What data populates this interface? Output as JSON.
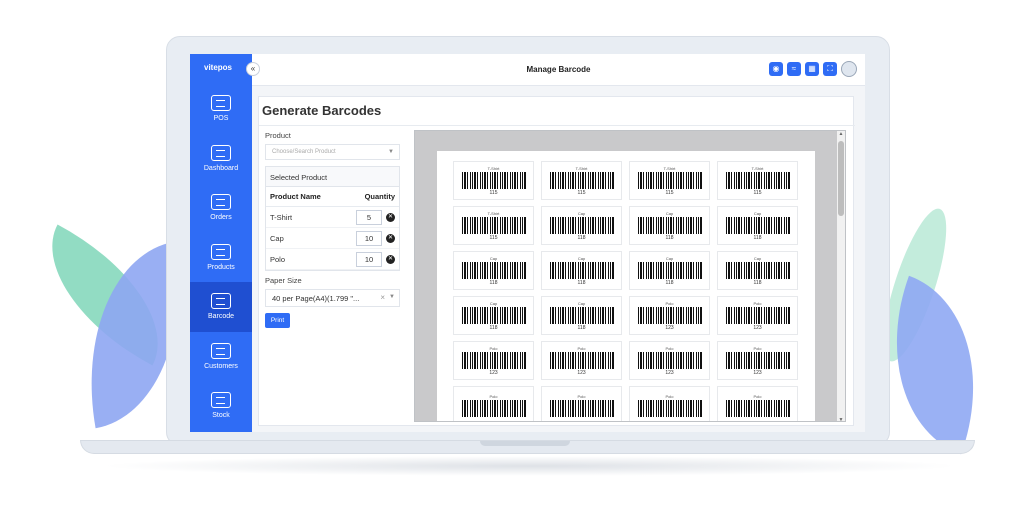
{
  "app": {
    "logo": "vitepos",
    "page_title": "Manage Barcode",
    "collapse_glyph": "«"
  },
  "sidebar": {
    "items": [
      {
        "label": "POS",
        "icon": "pos-icon"
      },
      {
        "label": "Dashboard",
        "icon": "dashboard-icon"
      },
      {
        "label": "Orders",
        "icon": "orders-icon"
      },
      {
        "label": "Products",
        "icon": "products-icon"
      },
      {
        "label": "Barcode",
        "icon": "barcode-icon",
        "active": true
      },
      {
        "label": "Customers",
        "icon": "customers-icon"
      },
      {
        "label": "Stock",
        "icon": "stock-icon"
      }
    ]
  },
  "topbar": {
    "icons": [
      "restaurant-icon",
      "wifi-icon",
      "calculator-icon",
      "fullscreen-icon"
    ],
    "accent_color": "#2f6cf5"
  },
  "main": {
    "title": "Generate Barcodes",
    "product_label": "Product",
    "product_placeholder": "Choose/Search Product",
    "selected_product_heading": "Selected Product",
    "table_headers": {
      "name": "Product Name",
      "quantity": "Quantity"
    },
    "products": [
      {
        "name": "T-Shirt",
        "qty": "5"
      },
      {
        "name": "Cap",
        "qty": "10"
      },
      {
        "name": "Polo",
        "qty": "10"
      }
    ],
    "paper_size_label": "Paper Size",
    "paper_size_value": "40 per Page(A4)(1.799 \"...",
    "clear_glyph": "×",
    "print_label": "Print"
  },
  "preview": {
    "labels": [
      {
        "name": "T-Shirt",
        "code": "115"
      },
      {
        "name": "T-Shirt",
        "code": "115"
      },
      {
        "name": "T-Shirt",
        "code": "115"
      },
      {
        "name": "T-Shirt",
        "code": "115"
      },
      {
        "name": "T-Shirt",
        "code": "115"
      },
      {
        "name": "Cap",
        "code": "118"
      },
      {
        "name": "Cap",
        "code": "118"
      },
      {
        "name": "Cap",
        "code": "118"
      },
      {
        "name": "Cap",
        "code": "118"
      },
      {
        "name": "Cap",
        "code": "118"
      },
      {
        "name": "Cap",
        "code": "118"
      },
      {
        "name": "Cap",
        "code": "118"
      },
      {
        "name": "Cap",
        "code": "118"
      },
      {
        "name": "Cap",
        "code": "118"
      },
      {
        "name": "Polo",
        "code": "123"
      },
      {
        "name": "Polo",
        "code": "123"
      },
      {
        "name": "Polo",
        "code": "123"
      },
      {
        "name": "Polo",
        "code": "123"
      },
      {
        "name": "Polo",
        "code": "123"
      },
      {
        "name": "Polo",
        "code": "123"
      },
      {
        "name": "Polo",
        "code": ""
      },
      {
        "name": "Polo",
        "code": ""
      },
      {
        "name": "Polo",
        "code": ""
      },
      {
        "name": "Polo",
        "code": ""
      }
    ]
  }
}
